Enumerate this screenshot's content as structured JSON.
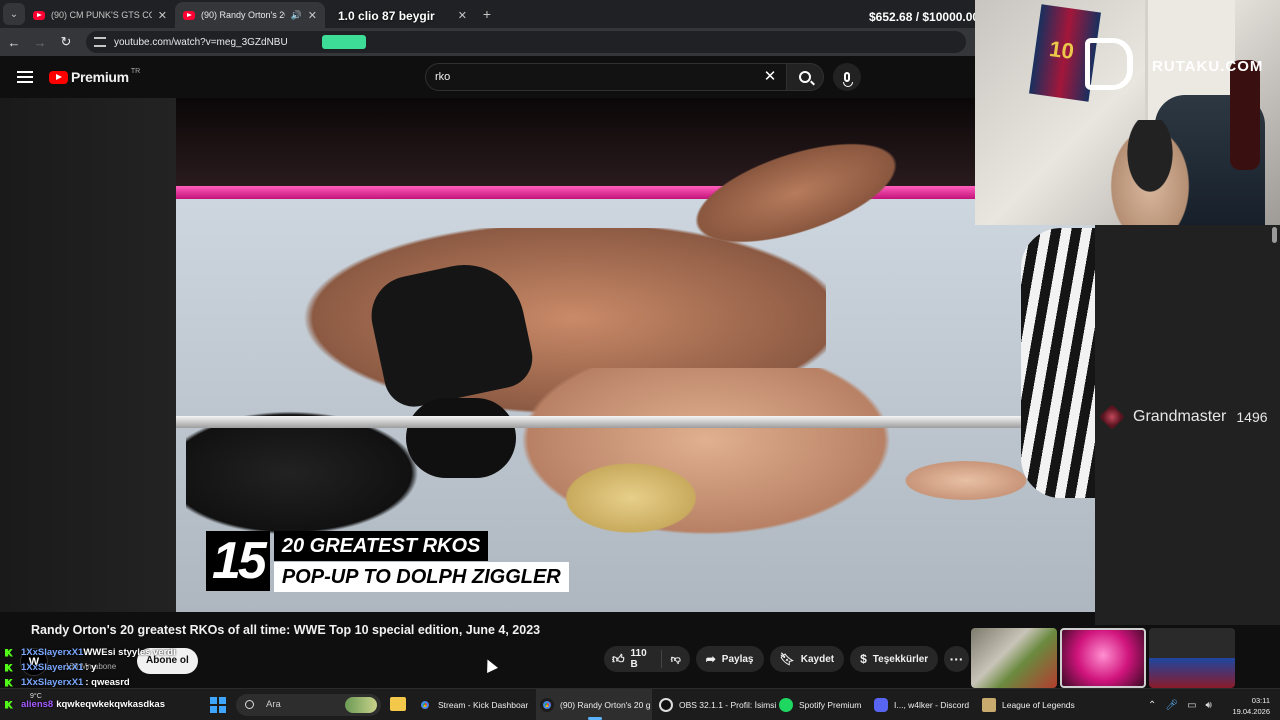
{
  "browser": {
    "tabs": [
      {
        "title": "(90) CM PUNK'S GTS COMPILATI"
      },
      {
        "title": "(90) Randy Orton's 20 greate"
      },
      {
        "title": "1.0 clio 87 beygir"
      }
    ],
    "new_tab_icon": "plus-icon",
    "url": "youtube.com/watch?v=meg_3GZdNBU"
  },
  "overlays": {
    "clio_text": "1.0 clio 87 beygir",
    "money_text": "$652.68 / $10000.00",
    "brand_text": "RUTAKU.COM",
    "rank_name": "Grandmaster",
    "rank_points": "1496"
  },
  "youtube": {
    "logo_word": "Premium",
    "country": "TR",
    "search_value": "rko",
    "video": {
      "lower_third_number": "15",
      "lower_third_line1": "20 GREATEST RKOS",
      "lower_third_line2": "POP-UP TO DOLPH ZIGGLER"
    },
    "title": "Randy Orton's 20 greatest RKOs of all time: WWE Top 10 special edition, June 4, 2023",
    "channel_avatar_text": "W",
    "subscribers": "133 Mn abone",
    "subscribe_label": "Abone ol",
    "likes": "110 B",
    "share_label": "Paylaş",
    "save_label": "Kaydet",
    "thanks_label": "Teşekkürler",
    "more_label": "···"
  },
  "chat": [
    {
      "user": "1XxSlayerxX1",
      "message": "WWEsi styyles verdi"
    },
    {
      "user": "1XxSlayerxX1",
      "message": ": y"
    },
    {
      "user": "1XxSlayerxX1",
      "message": ": qweasrd"
    },
    {
      "user": "aliens8",
      "message": "kqwkeqwkekqwkasdkas"
    }
  ],
  "taskbar": {
    "weather": "9°C",
    "search_placeholder": "Ara",
    "apps": [
      {
        "label": "Stream - Kick Dashboar"
      },
      {
        "label": "(90) Randy Orton's 20 g"
      },
      {
        "label": "OBS 32.1.1 - Profil: İsimsi"
      },
      {
        "label": "Spotify Premium"
      },
      {
        "label": "I..., w4lker - Discord"
      },
      {
        "label": "League of Legends"
      }
    ],
    "time": "03:11",
    "date": "19.04.2026"
  }
}
